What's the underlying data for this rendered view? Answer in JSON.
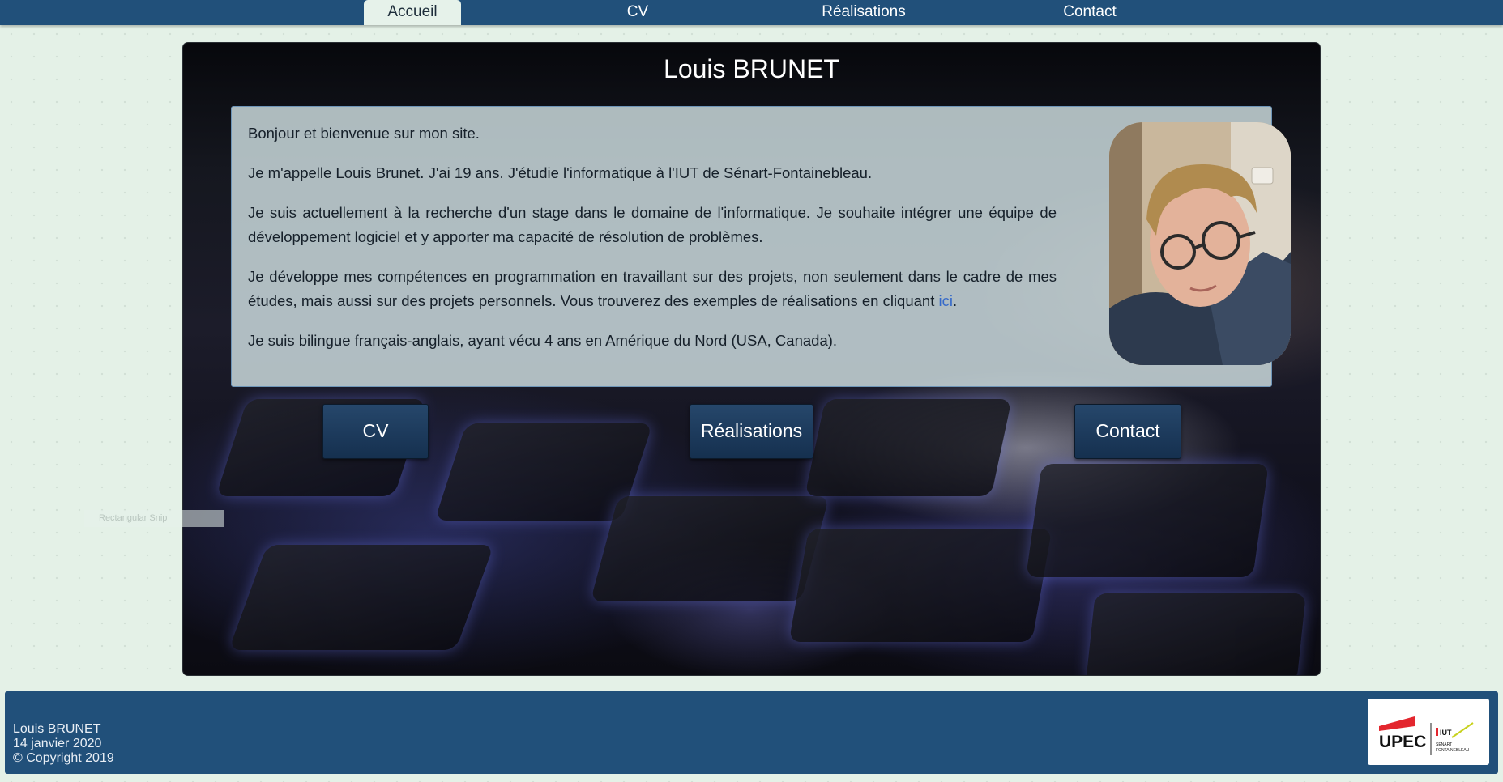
{
  "nav": {
    "tabs": [
      {
        "label": "Accueil",
        "active": true
      },
      {
        "label": "CV",
        "active": false
      },
      {
        "label": "Réalisations",
        "active": false
      },
      {
        "label": "Contact",
        "active": false
      }
    ]
  },
  "hero": {
    "title": "Louis BRUNET",
    "paragraphs": [
      "Bonjour et bienvenue sur mon site.",
      "Je m'appelle Louis Brunet. J'ai 19 ans. J'étudie l'informatique à l'IUT de Sénart-Fontainebleau.",
      "Je suis actuellement à la recherche d'un stage dans le domaine de l'informatique. Je souhaite intégrer une équipe de développement logiciel et y apporter ma capacité de résolution de problèmes.",
      "Je développe mes compétences en programmation en travaillant sur des projets, non seulement dans le cadre de mes études, mais aussi sur des projets personnels. Vous trouverez des exemples de réalisations en cliquant",
      "ici",
      ".",
      "Je suis bilingue français-anglais, ayant vécu 4 ans en Amérique du Nord (USA, Canada)."
    ],
    "buttons": {
      "cv": "CV",
      "realisations": "Réalisations",
      "contact": "Contact"
    }
  },
  "overlay": {
    "snip_label": "Rectangular Snip"
  },
  "footer": {
    "name": "Louis BRUNET",
    "date": "14 janvier 2020",
    "copyright": "© Copyright 2019",
    "logo": {
      "upec": "UPEC",
      "iut": "IUT",
      "senart": "SÉNART",
      "fontainebleau": "FONTAINEBLEAU"
    }
  },
  "colors": {
    "nav_bg": "#21507a",
    "page_bg": "#e4f1e7",
    "link": "#3569c9",
    "upec_red": "#e3262e"
  }
}
